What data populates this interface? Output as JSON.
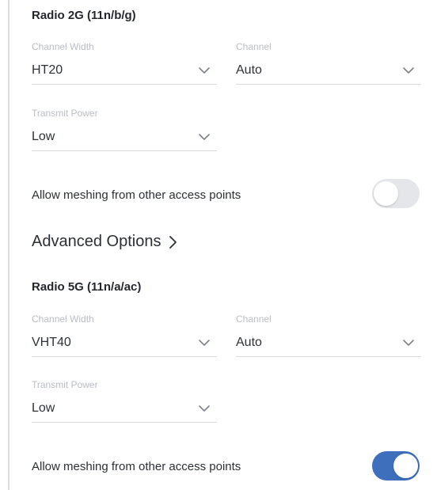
{
  "radio2g": {
    "title": "Radio 2G (11n/b/g)",
    "channel_width_label": "Channel Width",
    "channel_width_value": "HT20",
    "channel_label": "Channel",
    "channel_value": "Auto",
    "transmit_power_label": "Transmit Power",
    "transmit_power_value": "Low",
    "meshing_label": "Allow meshing from other access points",
    "meshing_enabled": false
  },
  "advanced": {
    "label": "Advanced Options"
  },
  "radio5g": {
    "title": "Radio 5G (11n/a/ac)",
    "channel_width_label": "Channel Width",
    "channel_width_value": "VHT40",
    "channel_label": "Channel",
    "channel_value": "Auto",
    "transmit_power_label": "Transmit Power",
    "transmit_power_value": "Low",
    "meshing_label": "Allow meshing from other access points",
    "meshing_enabled": true
  },
  "colors": {
    "toggle_on": "#3e6fbd",
    "toggle_off": "#e4e6ea",
    "label_muted": "#b9bdc5",
    "text_primary": "#2b2f36"
  },
  "icons": {
    "select_chevron": "chevron-down-icon",
    "advanced_chevron": "chevron-right-icon"
  }
}
